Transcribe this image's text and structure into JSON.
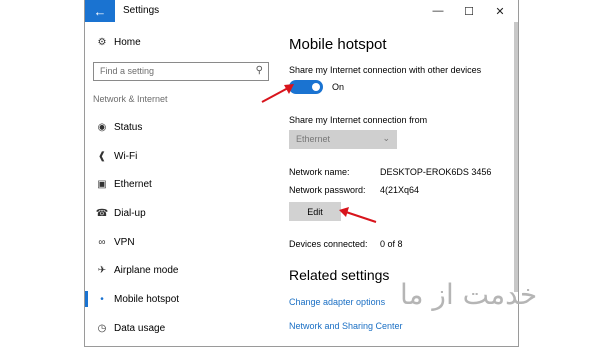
{
  "window": {
    "title": "Settings",
    "back_icon": "back-arrow-icon",
    "controls": [
      "minimize-icon",
      "maximize-icon",
      "close-icon"
    ]
  },
  "sidebar": {
    "home_label": "Home",
    "search_placeholder": "Find a setting",
    "group_label": "Network & Internet",
    "items": [
      {
        "label": "Status",
        "icon": "globe-icon"
      },
      {
        "label": "Wi-Fi",
        "icon": "wifi-icon"
      },
      {
        "label": "Ethernet",
        "icon": "ethernet-icon"
      },
      {
        "label": "Dial-up",
        "icon": "dialup-icon"
      },
      {
        "label": "VPN",
        "icon": "vpn-icon"
      },
      {
        "label": "Airplane mode",
        "icon": "airplane-icon"
      },
      {
        "label": "Mobile hotspot",
        "icon": "hotspot-icon",
        "active": true
      },
      {
        "label": "Data usage",
        "icon": "data-usage-icon"
      }
    ]
  },
  "main": {
    "title": "Mobile hotspot",
    "share_label": "Share my Internet connection with other devices",
    "toggle_state": "On",
    "share_from_label": "Share my Internet connection from",
    "share_from_value": "Ethernet",
    "network_name_label": "Network name:",
    "network_name_value": "DESKTOP-EROK6DS 3456",
    "network_password_label": "Network password:",
    "network_password_value": "4(21Xq64",
    "edit_label": "Edit",
    "devices_label": "Devices connected:",
    "devices_value": "0 of 8",
    "related_title": "Related settings",
    "links": [
      "Change adapter options",
      "Network and Sharing Center"
    ]
  },
  "watermark": "خدمت از ما",
  "colors": {
    "accent": "#1a73d1",
    "link": "#1a6fc4",
    "annotation_arrow": "#d8141c"
  }
}
